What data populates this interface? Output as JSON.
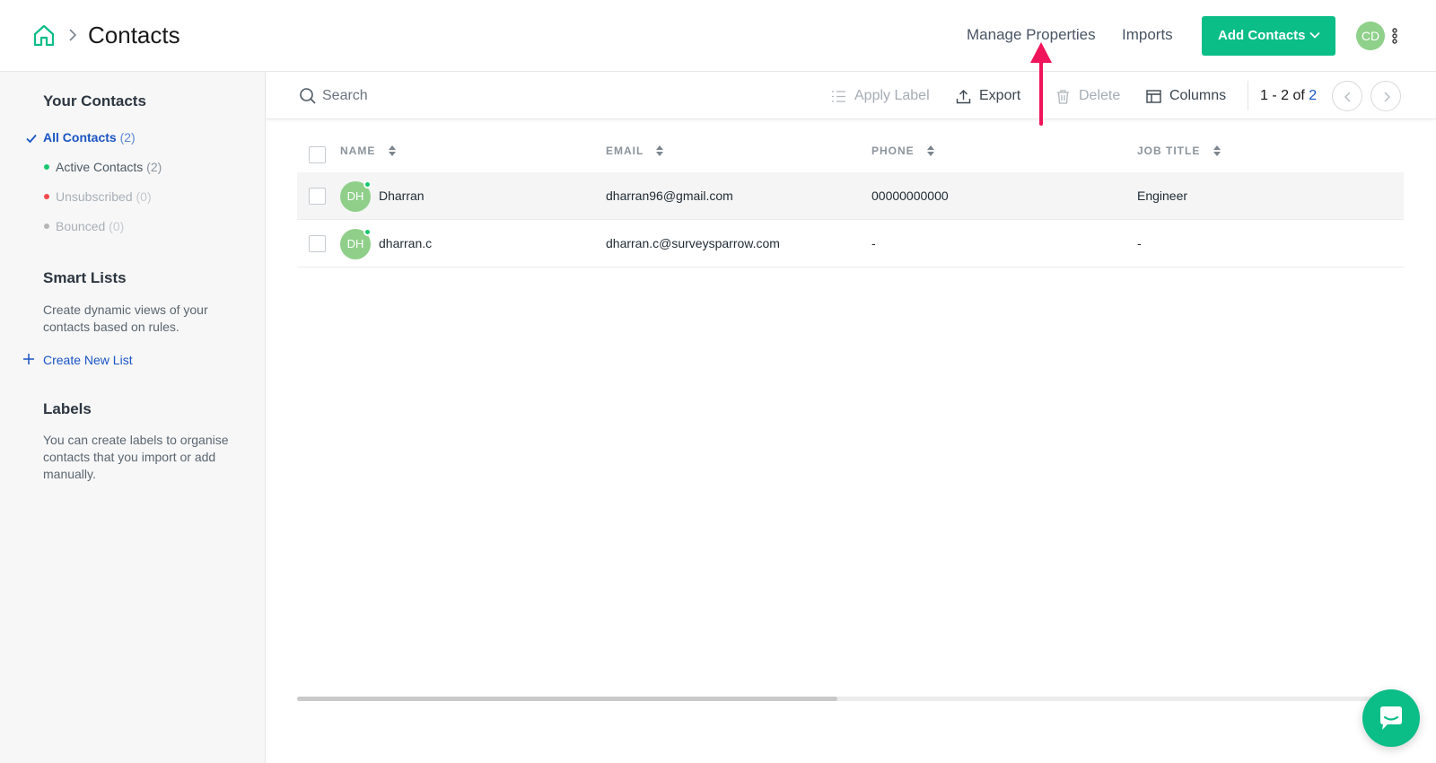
{
  "header": {
    "title": "Contacts",
    "manage_properties": "Manage Properties",
    "imports": "Imports",
    "add_contacts": "Add Contacts",
    "user_initials": "CD"
  },
  "sidebar": {
    "your_contacts_heading": "Your Contacts",
    "all_contacts": {
      "label": "All Contacts",
      "count": "(2)"
    },
    "active_contacts": {
      "label": "Active Contacts",
      "count": "(2)"
    },
    "unsubscribed": {
      "label": "Unsubscribed",
      "count": "(0)"
    },
    "bounced": {
      "label": "Bounced",
      "count": "(0)"
    },
    "smart_lists_heading": "Smart Lists",
    "smart_lists_desc": "Create dynamic views of your contacts based on rules.",
    "create_new_list": "Create New List",
    "labels_heading": "Labels",
    "labels_desc": "You can create labels to organise contacts that you import or add manually."
  },
  "toolbar": {
    "search_placeholder": "Search",
    "apply_label": "Apply Label",
    "export": "Export",
    "delete": "Delete",
    "columns": "Columns",
    "pager_range": "1 - 2",
    "pager_of": " of ",
    "pager_total": "2"
  },
  "table": {
    "columns": [
      "NAME",
      "EMAIL",
      "PHONE",
      "JOB TITLE"
    ],
    "rows": [
      {
        "initials": "DH",
        "name": "Dharran",
        "email": "dharran96@gmail.com",
        "phone": "00000000000",
        "job_title": "Engineer"
      },
      {
        "initials": "DH",
        "name": "dharran.c",
        "email": "dharran.c@surveysparrow.com",
        "phone": "-",
        "job_title": "-"
      }
    ]
  },
  "colors": {
    "brand_green": "#0bbd87",
    "link_blue": "#1a55c4",
    "annotation_arrow": "#f0145a",
    "status_active": "#18c76f",
    "status_unsubscribed": "#f04b4b",
    "status_bounced": "#b5b5b5"
  }
}
